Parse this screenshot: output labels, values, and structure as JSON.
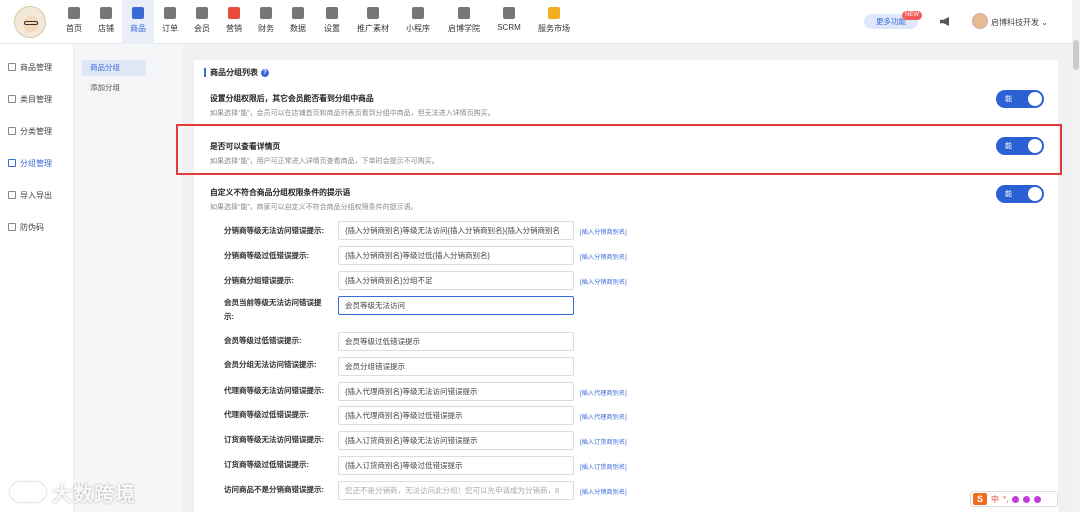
{
  "nav": {
    "items": [
      {
        "label": "首页",
        "icon": "home-icon",
        "color": "#666666"
      },
      {
        "label": "店铺",
        "icon": "store-icon",
        "color": "#666666"
      },
      {
        "label": "商品",
        "icon": "goods-icon",
        "color": "#3a6ad8",
        "active": true
      },
      {
        "label": "订单",
        "icon": "order-icon",
        "color": "#666666"
      },
      {
        "label": "会员",
        "icon": "member-icon",
        "color": "#666666"
      },
      {
        "label": "营销",
        "icon": "marketing-icon",
        "color": "#e84c3d"
      },
      {
        "label": "财务",
        "icon": "finance-icon",
        "color": "#666666"
      },
      {
        "label": "数据",
        "icon": "data-icon",
        "color": "#666666"
      },
      {
        "label": "设置",
        "icon": "settings-icon",
        "color": "#666666"
      },
      {
        "label": "推广素材",
        "icon": "share-icon",
        "color": "#666666"
      },
      {
        "label": "小程序",
        "icon": "miniprogram-icon",
        "color": "#666666"
      },
      {
        "label": "启博学院",
        "icon": "academy-icon",
        "color": "#666666"
      },
      {
        "label": "SCRM",
        "icon": "scrm-icon",
        "color": "#666666"
      },
      {
        "label": "服务市场",
        "icon": "service-market-icon",
        "color": "#f2b01e"
      }
    ],
    "more_button": "更多功能",
    "new_badge": "NEW",
    "user_name": "启博科技开发"
  },
  "sidebar": {
    "items": [
      {
        "label": "商品管理"
      },
      {
        "label": "类目管理"
      },
      {
        "label": "分类管理"
      },
      {
        "label": "分组管理",
        "active": true
      },
      {
        "label": "导入导出"
      },
      {
        "label": "防伪码"
      }
    ]
  },
  "sub_sidebar": {
    "items": [
      {
        "label": "商品分组",
        "active": true
      },
      {
        "label": "添加分组"
      }
    ]
  },
  "panel": {
    "title": "商品分组列表",
    "settings": [
      {
        "title": "设置分组权限后，其它会员能否看到分组中商品",
        "desc": "如果选择“能”，会员可以在店铺首页和商品列表页看到分组中商品，但无法进入详情页购买。",
        "toggle": "能"
      },
      {
        "title": "是否可以查看详情页",
        "desc": "如果选择“能”，用户可正常进入详情页查看商品，下单时会提示不可购买。",
        "toggle": "能"
      },
      {
        "title": "自定义不符合商品分组权限条件的提示语",
        "desc": "如果选择“能”，商家可以自定义不符合商品分组权限条件的提示语。",
        "toggle": "能"
      }
    ],
    "rows": [
      {
        "label": "分销商等级无法访问错误提示:",
        "value": "{插入分销商别名}等级无法访问{插入分销商别名}{插入分销商别名",
        "link": "[插入分销商别名]"
      },
      {
        "label": "分销商等级过低错误提示:",
        "value": "{插入分销商别名}等级过低{插入分销商别名}",
        "link": "[插入分销商别名]"
      },
      {
        "label": "分销商分组错误提示:",
        "value": "{插入分销商别名}分组不足",
        "link": "[插入分销商别名]"
      },
      {
        "label": "会员当前等级无法访问错误提示:",
        "value": "会员等级无法访问",
        "link": ""
      },
      {
        "label": "会员等级过低错误提示:",
        "value": "会员等级过低错误提示",
        "link": ""
      },
      {
        "label": "会员分组无法访问错误提示:",
        "value": "会员分组错误提示",
        "link": ""
      },
      {
        "label": "代理商等级无法访问错误提示:",
        "value": "{插入代理商别名}等级无法访问错误提示",
        "link": "[插入代理商别名]"
      },
      {
        "label": "代理商等级过低错误提示:",
        "value": "{插入代理商别名}等级过低错误提示",
        "link": "[插入代理商别名]"
      },
      {
        "label": "订货商等级无法访问错误提示:",
        "value": "{插入订货商别名}等级无法访问错误提示",
        "link": "[插入订货商别名]"
      },
      {
        "label": "订货商等级过低错误提示:",
        "value": "{插入订货商别名}等级过低错误提示",
        "link": "[插入订货商别名]"
      },
      {
        "label": "访问商品不是分销商错误提示:",
        "value": "您还不是分销商，无法访问此分组！您可以先申请成为分销商，8",
        "link": "[插入分销商别名]"
      }
    ]
  },
  "watermark": "大数跨境",
  "ime": {
    "logo": "S",
    "mode": "中"
  }
}
